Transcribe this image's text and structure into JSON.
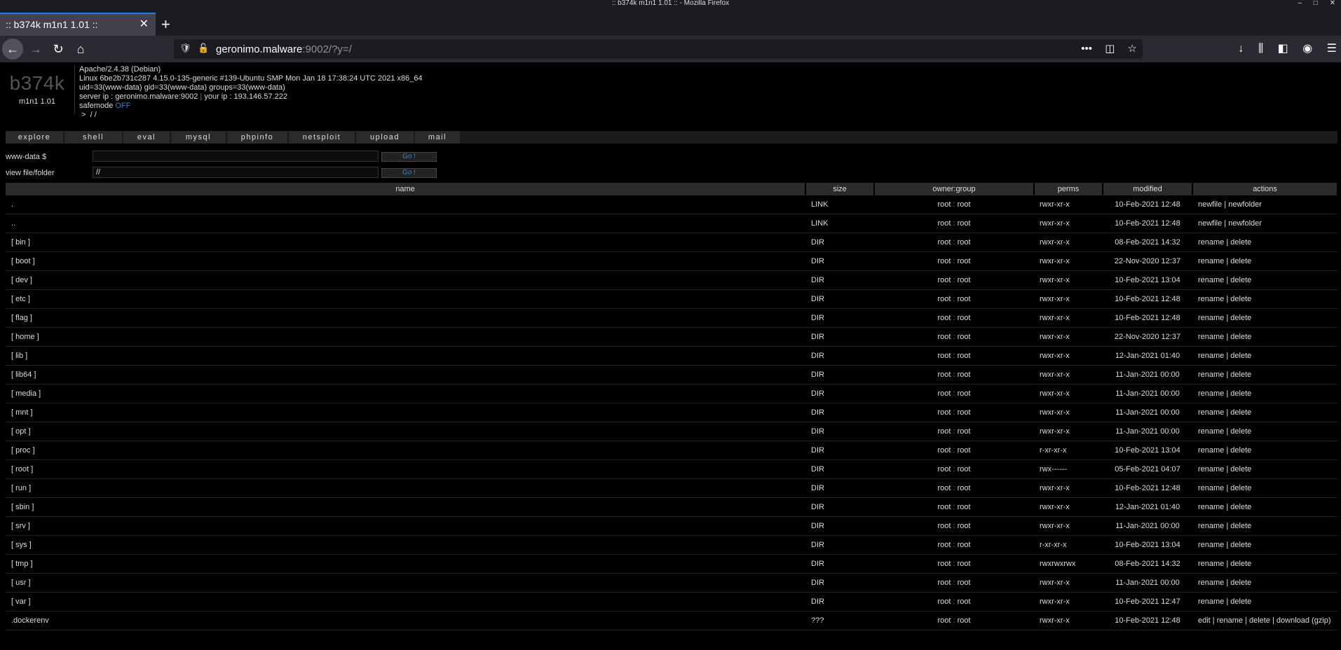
{
  "window": {
    "title": ":: b374k m1n1 1.01 :: - Mozilla Firefox",
    "controls": [
      "–",
      "□",
      "✕"
    ]
  },
  "tab": {
    "label": ":: b374k m1n1 1.01 ::",
    "close": "✕"
  },
  "newtab": "+",
  "nav": {
    "back": "←",
    "forward": "→",
    "reload": "↻",
    "home": "⌂"
  },
  "url": {
    "host": "geronimo.malware",
    "rest": ":9002/?y=/"
  },
  "urlbar_icons": {
    "shield": "🛡",
    "lock": "🔓",
    "more": "•••",
    "pocket": "◫",
    "star": "☆"
  },
  "toolbar_right": {
    "download": "↓",
    "library": "⫼",
    "sidebar": "◧",
    "account": "◉",
    "menu": "☰"
  },
  "logo": {
    "big": "b374k",
    "small": "m1n1 1.01"
  },
  "info": {
    "server": "Apache/2.4.38 (Debian)",
    "uname": "Linux 6be2b731c287 4.15.0-135-generic #139-Ubuntu SMP Mon Jan 18 17:38:24 UTC 2021 x86_64",
    "uid": "uid=33(www-data) gid=33(www-data) groups=33(www-data)",
    "server_ip_label": "server ip : geronimo.malware:9002",
    "pipe": "|",
    "your_ip_label": "your ip : 193.146.57.222",
    "safemode_label": "safemode",
    "safemode_value": "OFF",
    "path": " >  / /"
  },
  "menu": [
    "explore",
    "shell",
    "eval",
    "mysql",
    "phpinfo",
    "netsploit",
    "upload",
    "mail"
  ],
  "cmd": {
    "label": "www-data $",
    "value": "",
    "go": "Go !"
  },
  "view": {
    "label": "view file/folder",
    "value": "//",
    "go": "Go !"
  },
  "table": {
    "headers": [
      "name",
      "size",
      "owner:group",
      "perms",
      "modified",
      "actions"
    ],
    "rows": [
      {
        "name": ".",
        "size": "LINK",
        "owner": "root",
        "group": "root",
        "perms": "rwxr-xr-x",
        "modified": "10-Feb-2021 12:48",
        "actions": "newfile | newfolder"
      },
      {
        "name": "..",
        "size": "LINK",
        "owner": "root",
        "group": "root",
        "perms": "rwxr-xr-x",
        "modified": "10-Feb-2021 12:48",
        "actions": "newfile | newfolder"
      },
      {
        "name": "[ bin ]",
        "size": "DIR",
        "owner": "root",
        "group": "root",
        "perms": "rwxr-xr-x",
        "modified": "08-Feb-2021 14:32",
        "actions": "rename | delete"
      },
      {
        "name": "[ boot ]",
        "size": "DIR",
        "owner": "root",
        "group": "root",
        "perms": "rwxr-xr-x",
        "modified": "22-Nov-2020 12:37",
        "actions": "rename | delete"
      },
      {
        "name": "[ dev ]",
        "size": "DIR",
        "owner": "root",
        "group": "root",
        "perms": "rwxr-xr-x",
        "modified": "10-Feb-2021 13:04",
        "actions": "rename | delete"
      },
      {
        "name": "[ etc ]",
        "size": "DIR",
        "owner": "root",
        "group": "root",
        "perms": "rwxr-xr-x",
        "modified": "10-Feb-2021 12:48",
        "actions": "rename | delete"
      },
      {
        "name": "[ flag ]",
        "size": "DIR",
        "owner": "root",
        "group": "root",
        "perms": "rwxr-xr-x",
        "modified": "10-Feb-2021 12:48",
        "actions": "rename | delete"
      },
      {
        "name": "[ home ]",
        "size": "DIR",
        "owner": "root",
        "group": "root",
        "perms": "rwxr-xr-x",
        "modified": "22-Nov-2020 12:37",
        "actions": "rename | delete"
      },
      {
        "name": "[ lib ]",
        "size": "DIR",
        "owner": "root",
        "group": "root",
        "perms": "rwxr-xr-x",
        "modified": "12-Jan-2021 01:40",
        "actions": "rename | delete"
      },
      {
        "name": "[ lib64 ]",
        "size": "DIR",
        "owner": "root",
        "group": "root",
        "perms": "rwxr-xr-x",
        "modified": "11-Jan-2021 00:00",
        "actions": "rename | delete"
      },
      {
        "name": "[ media ]",
        "size": "DIR",
        "owner": "root",
        "group": "root",
        "perms": "rwxr-xr-x",
        "modified": "11-Jan-2021 00:00",
        "actions": "rename | delete"
      },
      {
        "name": "[ mnt ]",
        "size": "DIR",
        "owner": "root",
        "group": "root",
        "perms": "rwxr-xr-x",
        "modified": "11-Jan-2021 00:00",
        "actions": "rename | delete"
      },
      {
        "name": "[ opt ]",
        "size": "DIR",
        "owner": "root",
        "group": "root",
        "perms": "rwxr-xr-x",
        "modified": "11-Jan-2021 00:00",
        "actions": "rename | delete"
      },
      {
        "name": "[ proc ]",
        "size": "DIR",
        "owner": "root",
        "group": "root",
        "perms": "r-xr-xr-x",
        "modified": "10-Feb-2021 13:04",
        "actions": "rename | delete"
      },
      {
        "name": "[ root ]",
        "size": "DIR",
        "owner": "root",
        "group": "root",
        "perms": "rwx------",
        "modified": "05-Feb-2021 04:07",
        "actions": "rename | delete"
      },
      {
        "name": "[ run ]",
        "size": "DIR",
        "owner": "root",
        "group": "root",
        "perms": "rwxr-xr-x",
        "modified": "10-Feb-2021 12:48",
        "actions": "rename | delete"
      },
      {
        "name": "[ sbin ]",
        "size": "DIR",
        "owner": "root",
        "group": "root",
        "perms": "rwxr-xr-x",
        "modified": "12-Jan-2021 01:40",
        "actions": "rename | delete"
      },
      {
        "name": "[ srv ]",
        "size": "DIR",
        "owner": "root",
        "group": "root",
        "perms": "rwxr-xr-x",
        "modified": "11-Jan-2021 00:00",
        "actions": "rename | delete"
      },
      {
        "name": "[ sys ]",
        "size": "DIR",
        "owner": "root",
        "group": "root",
        "perms": "r-xr-xr-x",
        "modified": "10-Feb-2021 13:04",
        "actions": "rename | delete"
      },
      {
        "name": "[ tmp ]",
        "size": "DIR",
        "owner": "root",
        "group": "root",
        "perms": "rwxrwxrwx",
        "modified": "08-Feb-2021 14:32",
        "actions": "rename | delete"
      },
      {
        "name": "[ usr ]",
        "size": "DIR",
        "owner": "root",
        "group": "root",
        "perms": "rwxr-xr-x",
        "modified": "11-Jan-2021 00:00",
        "actions": "rename | delete"
      },
      {
        "name": "[ var ]",
        "size": "DIR",
        "owner": "root",
        "group": "root",
        "perms": "rwxr-xr-x",
        "modified": "10-Feb-2021 12:47",
        "actions": "rename | delete"
      },
      {
        "name": ".dockerenv",
        "size": "???",
        "owner": "root",
        "group": "root",
        "perms": "rwxr-xr-x",
        "modified": "10-Feb-2021 12:48",
        "actions": "edit | rename | delete | download (gzip)"
      }
    ]
  }
}
